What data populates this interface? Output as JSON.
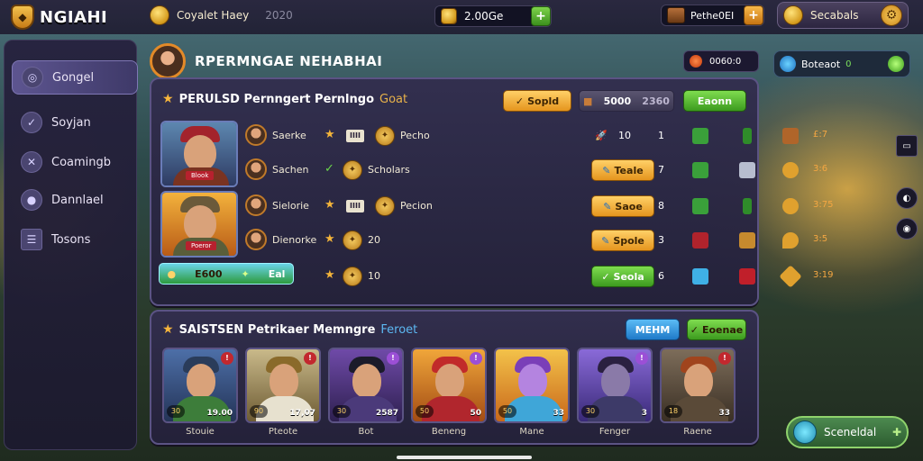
{
  "app": {
    "logo_text": "NGIAHI"
  },
  "topbar": {
    "player_name": "Coyalet Haey",
    "player_level": "2020",
    "gold": "2.00Ge",
    "gems": "Pethe0EI",
    "season": "Secabals"
  },
  "sidebar": {
    "items": [
      {
        "label": "Gongel",
        "icon": "swirl-icon"
      },
      {
        "label": "Soyjan",
        "icon": "chevron-icon"
      },
      {
        "label": "Coamingb",
        "icon": "crossed-icon"
      },
      {
        "label": "Dannlael",
        "icon": "people-icon"
      },
      {
        "label": "Tosons",
        "icon": "list-icon"
      }
    ]
  },
  "header": {
    "title": "RPERMNGAE NEHABHAI",
    "timer": "0060:0",
    "boost_label": "Boteaot",
    "boost_value": "0"
  },
  "panel_top": {
    "title": "PERULSD Pernngert Pernlngo",
    "accent": "Goat",
    "btn_status": "Sopld",
    "counter_a": "5000",
    "counter_b": "2360",
    "btn_action": "Eaonn",
    "hero_tags": [
      "Blook",
      "Poeror"
    ],
    "bottom_pill": {
      "left": "E600",
      "right": "Eal"
    },
    "rows": [
      {
        "name": "Saerke",
        "badge": "IIII",
        "label": "Pecho",
        "btn": "",
        "num": "10",
        "count": "1",
        "val": "£:7"
      },
      {
        "name": "Sachen",
        "badge": "",
        "label": "Scholars",
        "btn": "Teale",
        "num": "7",
        "count": "",
        "val": "3:6"
      },
      {
        "name": "Sielorie",
        "badge": "IIII",
        "label": "Pecion",
        "btn": "Saoe",
        "num": "8",
        "count": "",
        "val": "3:75"
      },
      {
        "name": "Dienorke",
        "badge": "",
        "label": "20",
        "btn": "Spole",
        "num": "3",
        "count": "",
        "val": "3:5"
      },
      {
        "name": "",
        "badge": "",
        "label": "10",
        "btn": "Seola",
        "num": "6",
        "count": "",
        "val": "3:19"
      }
    ]
  },
  "panel_bottom": {
    "title": "SAISTSEN Petrikaer Memngre",
    "accent": "Feroet",
    "btn_a": "MEHM",
    "btn_b": "Eoenae",
    "cards": [
      {
        "name": "Stouie",
        "level": "30",
        "power": "19.00"
      },
      {
        "name": "Pteote",
        "level": "90",
        "power": "17,07"
      },
      {
        "name": "Bot",
        "level": "30",
        "power": "2587"
      },
      {
        "name": "Beneng",
        "level": "50",
        "power": "50"
      },
      {
        "name": "Mane",
        "level": "50",
        "power": "33"
      },
      {
        "name": "Fenger",
        "level": "30",
        "power": "3"
      },
      {
        "name": "Raene",
        "level": "18",
        "power": "33"
      }
    ]
  },
  "social": {
    "label": "Sceneldal"
  },
  "colors": {
    "accent_gold": "#f3b43a",
    "accent_green": "#6bd64b",
    "panel_border": "#5b5384"
  }
}
